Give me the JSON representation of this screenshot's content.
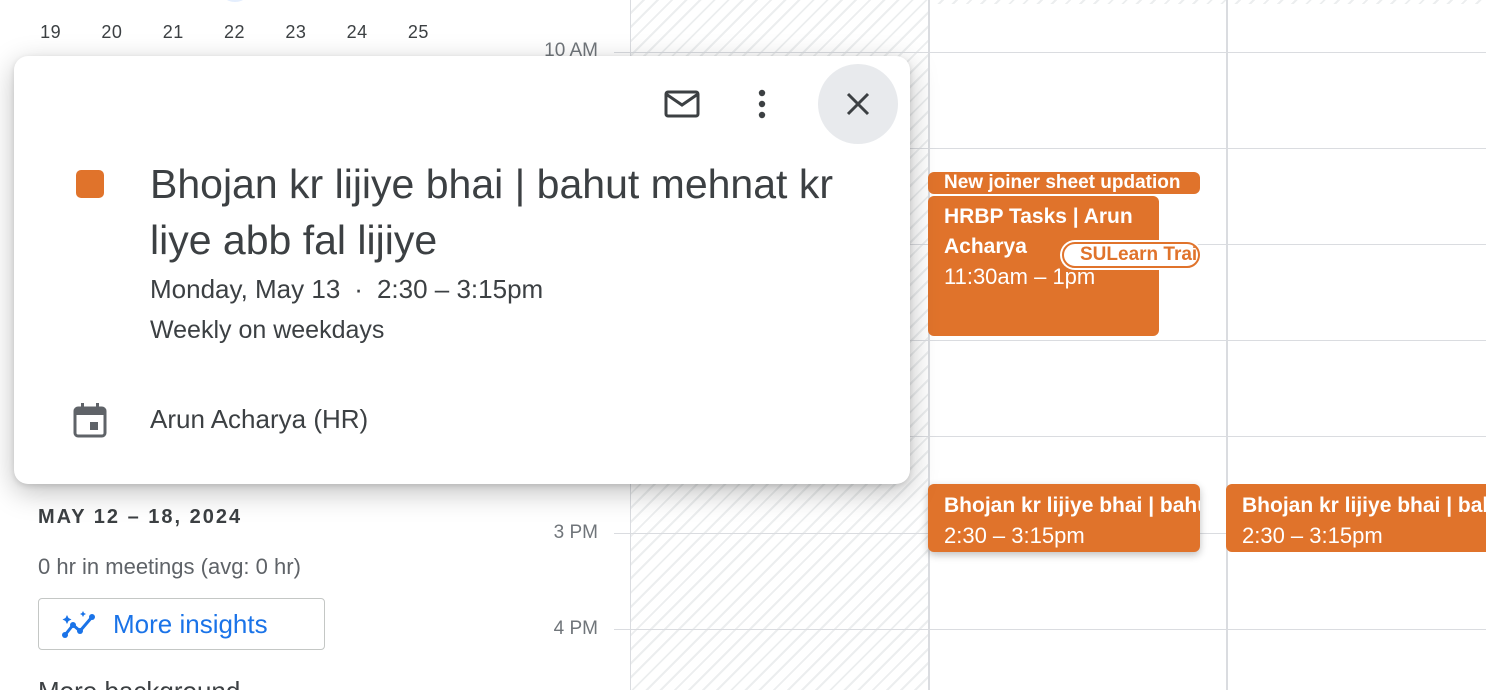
{
  "mini_calendar": {
    "days": [
      "19",
      "20",
      "21",
      "22",
      "23",
      "24",
      "25"
    ]
  },
  "sidebar": {
    "week_range": "MAY 12 – 18, 2024",
    "meetings": "0 hr in meetings (avg: 0 hr)",
    "insights_button": "More insights",
    "cut_heading": "More background"
  },
  "time_labels": {
    "ten_am": "10 AM",
    "three_pm": "3 PM",
    "four_pm": "4 PM"
  },
  "events": {
    "joiner": "New joiner sheet updation",
    "hrbp_title": "HRBP Tasks | Arun Acharya",
    "hrbp_time": "11:30am – 1pm",
    "sulearn": "SULearn Training",
    "bhojan1_title": "Bhojan kr lijiye bhai | bahut mehnat kr liye abb fal lijiye",
    "bhojan1_time": "2:30 – 3:15pm",
    "bhojan2_title": "Bhojan kr lijiye bhai | bahut mehnat kr liye abb fal lijiye",
    "bhojan2_time": "2:30 – 3:15pm",
    "color": "#e0732b"
  },
  "popup": {
    "title": "Bhojan kr lijiye bhai | bahut mehnat kr liye abb fal lijiye",
    "date": "Monday, May 13",
    "separator": "·",
    "time": "2:30 – 3:15pm",
    "recurrence": "Weekly on weekdays",
    "calendar": "Arun Acharya (HR)",
    "icons": [
      "mail-icon",
      "more-vert-icon",
      "close-icon",
      "calendar-icon"
    ]
  }
}
